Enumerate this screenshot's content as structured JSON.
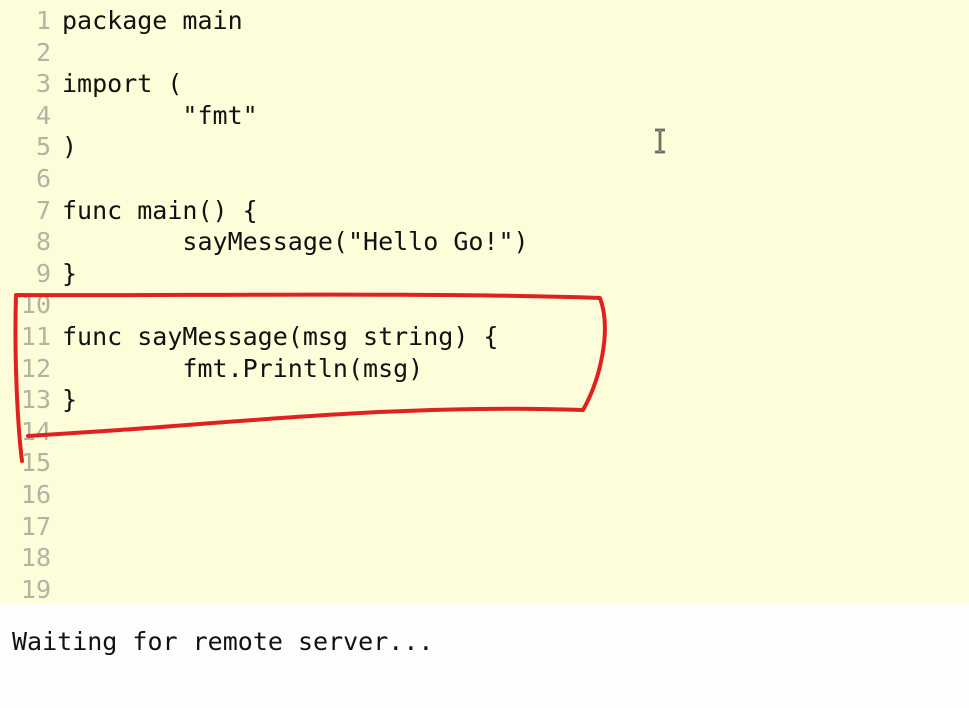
{
  "editor": {
    "language": "Go",
    "lines": [
      {
        "number": "1",
        "text": "package main"
      },
      {
        "number": "2",
        "text": ""
      },
      {
        "number": "3",
        "text": "import ("
      },
      {
        "number": "4",
        "text": "        \"fmt\""
      },
      {
        "number": "5",
        "text": ")"
      },
      {
        "number": "6",
        "text": ""
      },
      {
        "number": "7",
        "text": "func main() {"
      },
      {
        "number": "8",
        "text": "        sayMessage(\"Hello Go!\")"
      },
      {
        "number": "9",
        "text": "}"
      },
      {
        "number": "10",
        "text": ""
      },
      {
        "number": "11",
        "text": "func sayMessage(msg string) {"
      },
      {
        "number": "12",
        "text": "        fmt.Println(msg)"
      },
      {
        "number": "13",
        "text": "}"
      },
      {
        "number": "14",
        "text": ""
      },
      {
        "number": "15",
        "text": ""
      },
      {
        "number": "16",
        "text": ""
      },
      {
        "number": "17",
        "text": ""
      },
      {
        "number": "18",
        "text": ""
      },
      {
        "number": "19",
        "text": ""
      }
    ],
    "background_color": "#fefdda",
    "line_number_color": "#b3b3a3",
    "highlight_color": "#e0211f"
  },
  "output": {
    "status_text": "Waiting for remote server..."
  }
}
